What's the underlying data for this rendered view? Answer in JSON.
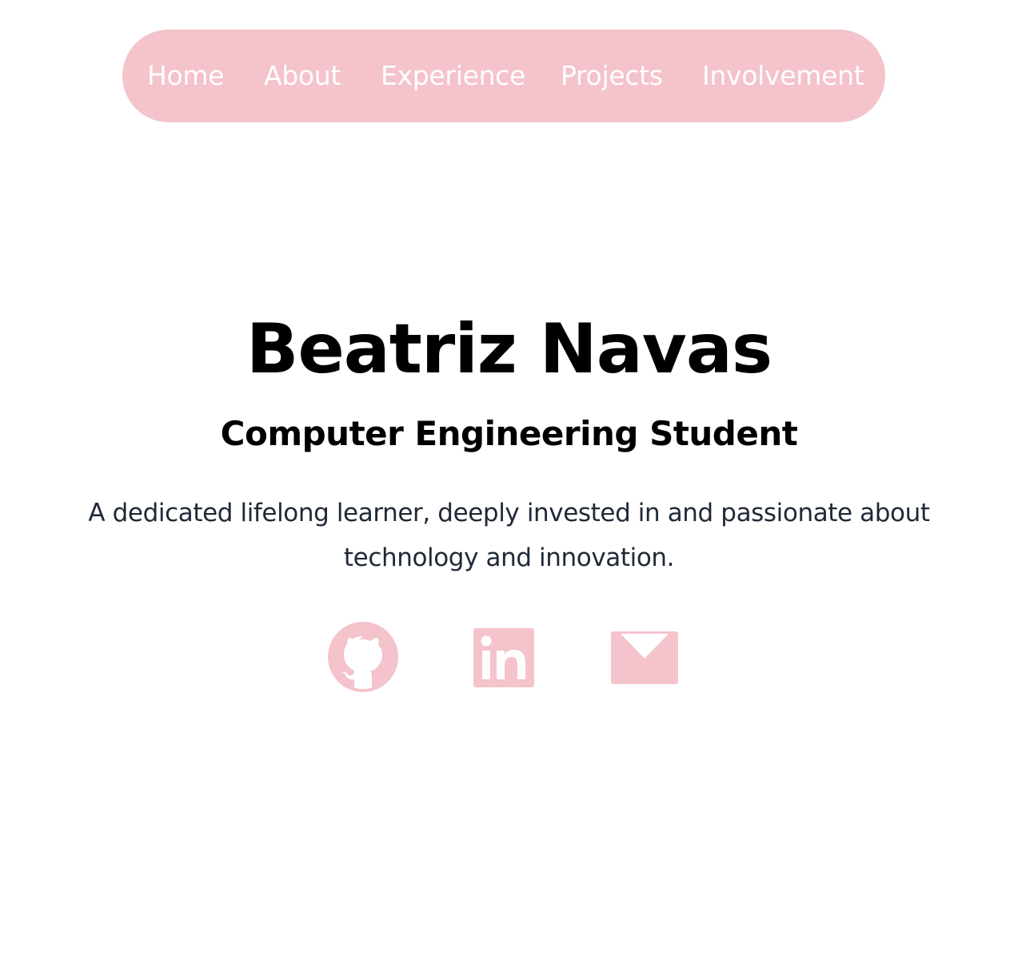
{
  "nav": {
    "items": [
      {
        "label": "Home"
      },
      {
        "label": "About"
      },
      {
        "label": "Experience"
      },
      {
        "label": "Projects"
      },
      {
        "label": "Involvement"
      }
    ]
  },
  "hero": {
    "name": "Beatriz Navas",
    "role": "Computer Engineering Student",
    "bio": "A dedicated lifelong learner, deeply invested in and passionate about technology and innovation."
  },
  "social": {
    "icons": [
      "github-icon",
      "linkedin-icon",
      "email-icon"
    ]
  },
  "colors": {
    "accent": "#f4c3cb",
    "nav_text": "#ffffff",
    "heading": "#000000",
    "body_text": "#1f2937",
    "background": "#ffffff"
  }
}
